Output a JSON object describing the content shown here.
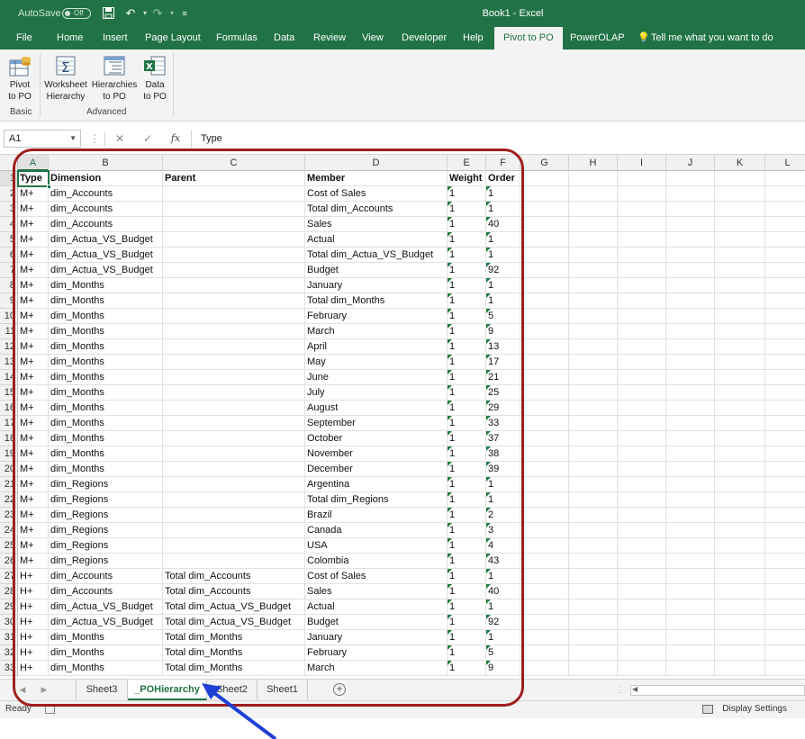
{
  "titlebar": {
    "autosave_label": "AutoSave",
    "autosave_state": "Off",
    "window_title": "Book1  -  Excel"
  },
  "tabs": [
    "File",
    "Home",
    "Insert",
    "Page Layout",
    "Formulas",
    "Data",
    "Review",
    "View",
    "Developer",
    "Help",
    "Pivot to PO",
    "PowerOLAP"
  ],
  "active_tab": "Pivot to PO",
  "tell_me": "Tell me what you want to do",
  "ribbon": {
    "buttons": [
      {
        "line1": "Pivot",
        "line2": "to PO",
        "icon": "pivot-table-icon"
      },
      {
        "line1": "Worksheet",
        "line2": "Hierarchy",
        "icon": "sigma-sheet-icon"
      },
      {
        "line1": "Hierarchies",
        "line2": "to PO",
        "icon": "hierarchy-icon"
      },
      {
        "line1": "Data",
        "line2": "to PO",
        "icon": "excel-data-icon"
      }
    ],
    "groups": [
      "Basic",
      "Advanced"
    ]
  },
  "formula_bar": {
    "name_box": "A1",
    "formula": "Type"
  },
  "columns": [
    "A",
    "B",
    "C",
    "D",
    "E",
    "F",
    "G",
    "H",
    "I",
    "J",
    "K",
    "L"
  ],
  "header_row": [
    "Type",
    "Dimension",
    "Parent",
    "Member",
    "Weight",
    "Order"
  ],
  "rows": [
    [
      "M+",
      "dim_Accounts",
      "",
      "Cost of Sales",
      "1",
      "1"
    ],
    [
      "M+",
      "dim_Accounts",
      "",
      "Total dim_Accounts",
      "1",
      "1"
    ],
    [
      "M+",
      "dim_Accounts",
      "",
      "Sales",
      "1",
      "40"
    ],
    [
      "M+",
      "dim_Actua_VS_Budget",
      "",
      "Actual",
      "1",
      "1"
    ],
    [
      "M+",
      "dim_Actua_VS_Budget",
      "",
      "Total dim_Actua_VS_Budget",
      "1",
      "1"
    ],
    [
      "M+",
      "dim_Actua_VS_Budget",
      "",
      "Budget",
      "1",
      "92"
    ],
    [
      "M+",
      "dim_Months",
      "",
      "January",
      "1",
      "1"
    ],
    [
      "M+",
      "dim_Months",
      "",
      "Total dim_Months",
      "1",
      "1"
    ],
    [
      "M+",
      "dim_Months",
      "",
      "February",
      "1",
      "5"
    ],
    [
      "M+",
      "dim_Months",
      "",
      "March",
      "1",
      "9"
    ],
    [
      "M+",
      "dim_Months",
      "",
      "April",
      "1",
      "13"
    ],
    [
      "M+",
      "dim_Months",
      "",
      "May",
      "1",
      "17"
    ],
    [
      "M+",
      "dim_Months",
      "",
      "June",
      "1",
      "21"
    ],
    [
      "M+",
      "dim_Months",
      "",
      "July",
      "1",
      "25"
    ],
    [
      "M+",
      "dim_Months",
      "",
      "August",
      "1",
      "29"
    ],
    [
      "M+",
      "dim_Months",
      "",
      "September",
      "1",
      "33"
    ],
    [
      "M+",
      "dim_Months",
      "",
      "October",
      "1",
      "37"
    ],
    [
      "M+",
      "dim_Months",
      "",
      "November",
      "1",
      "38"
    ],
    [
      "M+",
      "dim_Months",
      "",
      "December",
      "1",
      "39"
    ],
    [
      "M+",
      "dim_Regions",
      "",
      "Argentina",
      "1",
      "1"
    ],
    [
      "M+",
      "dim_Regions",
      "",
      "Total dim_Regions",
      "1",
      "1"
    ],
    [
      "M+",
      "dim_Regions",
      "",
      "Brazil",
      "1",
      "2"
    ],
    [
      "M+",
      "dim_Regions",
      "",
      "Canada",
      "1",
      "3"
    ],
    [
      "M+",
      "dim_Regions",
      "",
      "USA",
      "1",
      "4"
    ],
    [
      "M+",
      "dim_Regions",
      "",
      "Colombia",
      "1",
      "43"
    ],
    [
      "H+",
      "dim_Accounts",
      "Total dim_Accounts",
      "Cost of Sales",
      "1",
      "1"
    ],
    [
      "H+",
      "dim_Accounts",
      "Total dim_Accounts",
      "Sales",
      "1",
      "40"
    ],
    [
      "H+",
      "dim_Actua_VS_Budget",
      "Total dim_Actua_VS_Budget",
      "Actual",
      "1",
      "1"
    ],
    [
      "H+",
      "dim_Actua_VS_Budget",
      "Total dim_Actua_VS_Budget",
      "Budget",
      "1",
      "92"
    ],
    [
      "H+",
      "dim_Months",
      "Total dim_Months",
      "January",
      "1",
      "1"
    ],
    [
      "H+",
      "dim_Months",
      "Total dim_Months",
      "February",
      "1",
      "5"
    ],
    [
      "H+",
      "dim_Months",
      "Total dim_Months",
      "March",
      "1",
      "9"
    ]
  ],
  "sheets": [
    "Sheet3",
    "_POHierarchy",
    "Sheet2",
    "Sheet1"
  ],
  "active_sheet": "_POHierarchy",
  "status": {
    "ready": "Ready",
    "display_settings": "Display Settings"
  },
  "colors": {
    "excel_green": "#217346",
    "annotation_red": "#a01e1e",
    "annotation_arrow": "#1f3fd6",
    "error_triangle": "#1e7a3c"
  }
}
